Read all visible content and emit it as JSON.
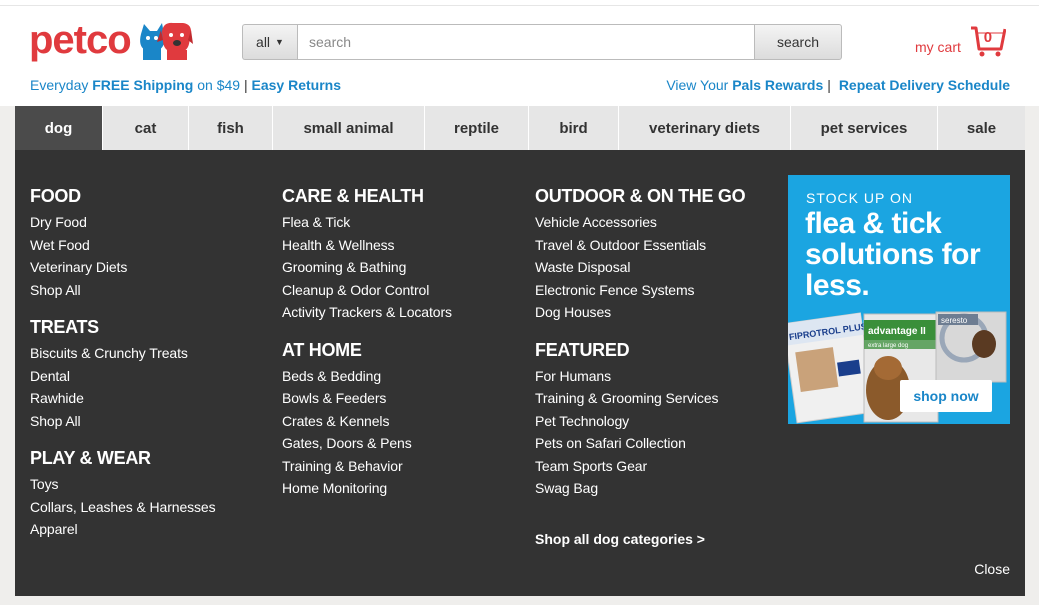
{
  "brand": {
    "logo_text": "petco",
    "accent": "#e03a3e",
    "link_color": "#1a86c8"
  },
  "search": {
    "scope": "all",
    "placeholder": "search",
    "button": "search"
  },
  "cart": {
    "label": "my cart",
    "count": "0",
    "icon": "cart-icon"
  },
  "promo": {
    "prefix": "Everyday ",
    "free_shipping": "FREE Shipping",
    "suffix": " on $49",
    "sep": "|",
    "returns": "Easy Returns",
    "rewards_prefix": "View Your ",
    "rewards_bold": "Pals Rewards",
    "rewards_sep": "|",
    "repeat_delivery": "Repeat Delivery Schedule"
  },
  "nav": [
    {
      "label": "dog",
      "active": true
    },
    {
      "label": "cat"
    },
    {
      "label": "fish"
    },
    {
      "label": "small animal"
    },
    {
      "label": "reptile"
    },
    {
      "label": "bird"
    },
    {
      "label": "veterinary diets"
    },
    {
      "label": "pet services"
    },
    {
      "label": "sale"
    }
  ],
  "menu": {
    "col1": [
      {
        "title": "FOOD",
        "links": [
          "Dry Food",
          "Wet Food",
          "Veterinary Diets",
          "Shop All"
        ]
      },
      {
        "title": "TREATS",
        "links": [
          "Biscuits & Crunchy Treats",
          "Dental",
          "Rawhide",
          "Shop All"
        ]
      },
      {
        "title": "PLAY & WEAR",
        "links": [
          "Toys",
          "Collars, Leashes & Harnesses",
          "Apparel"
        ]
      }
    ],
    "col2": [
      {
        "title": "CARE & HEALTH",
        "links": [
          "Flea & Tick",
          "Health & Wellness",
          "Grooming & Bathing",
          "Cleanup & Odor Control",
          "Activity Trackers & Locators"
        ]
      },
      {
        "title": "AT HOME",
        "links": [
          "Beds & Bedding",
          "Bowls & Feeders",
          "Crates & Kennels",
          "Gates, Doors & Pens",
          "Training & Behavior",
          "Home Monitoring"
        ]
      }
    ],
    "col3": [
      {
        "title": "OUTDOOR & ON THE GO",
        "links": [
          "Vehicle Accessories",
          "Travel & Outdoor Essentials",
          "Waste Disposal",
          "Electronic Fence Systems",
          "Dog Houses"
        ]
      },
      {
        "title": "FEATURED",
        "links": [
          "For Humans",
          "Training & Grooming Services",
          "Pet Technology",
          "Pets on Safari Collection",
          "Team Sports Gear",
          "Swag Bag"
        ]
      }
    ],
    "shop_all": "Shop all dog categories >",
    "close": "Close"
  },
  "ad": {
    "kicker": "STOCK UP ON",
    "headline": "flea & tick solutions for less.",
    "button": "shop now",
    "product_texts": [
      "FIPROTROL PLUS",
      "advantage II",
      "extra large dog",
      "seresto"
    ],
    "bg": "#1ba5e1"
  }
}
